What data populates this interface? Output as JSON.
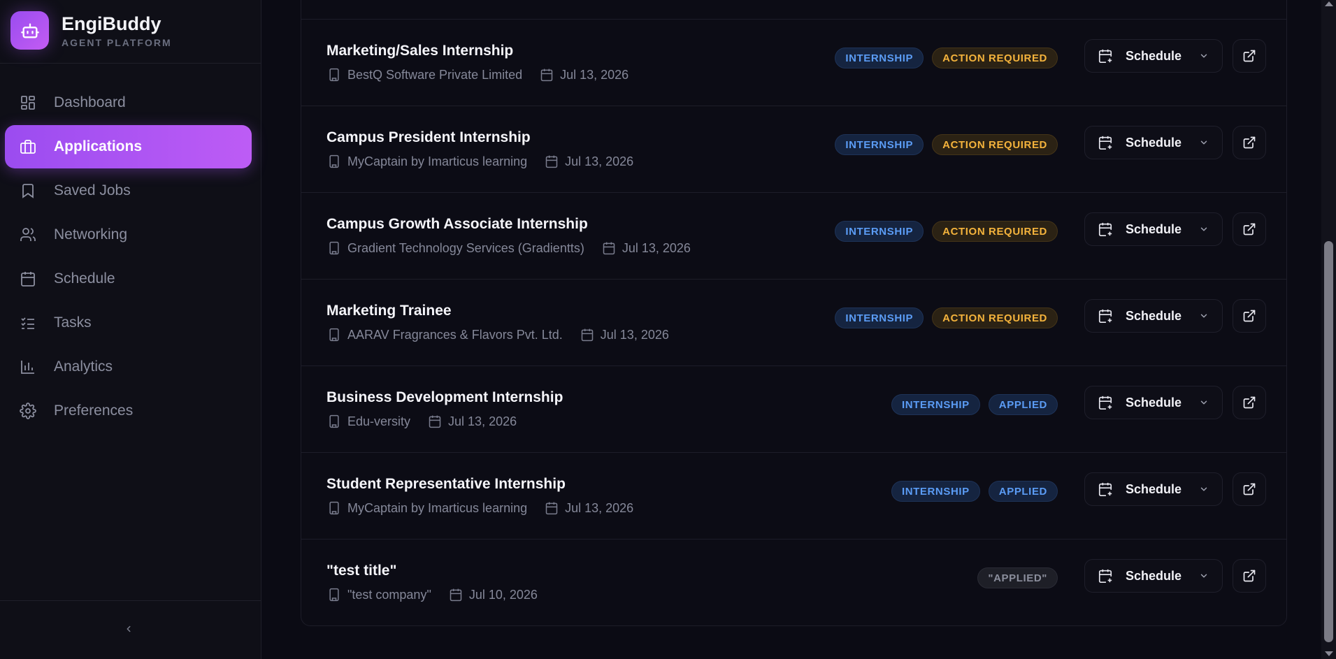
{
  "brand": {
    "name": "EngiBuddy",
    "subtitle": "AGENT PLATFORM",
    "icon": "robot-icon"
  },
  "sidebar": {
    "items": [
      {
        "label": "Dashboard",
        "icon": "dashboard-icon",
        "active": false
      },
      {
        "label": "Applications",
        "icon": "briefcase-icon",
        "active": true
      },
      {
        "label": "Saved Jobs",
        "icon": "bookmark-icon",
        "active": false
      },
      {
        "label": "Networking",
        "icon": "users-icon",
        "active": false
      },
      {
        "label": "Schedule",
        "icon": "calendar-icon",
        "active": false
      },
      {
        "label": "Tasks",
        "icon": "list-checks-icon",
        "active": false
      },
      {
        "label": "Analytics",
        "icon": "bar-chart-icon",
        "active": false
      },
      {
        "label": "Preferences",
        "icon": "gear-icon",
        "active": false
      }
    ],
    "collapse_icon": "chevron-left-icon"
  },
  "applications": [
    {
      "title": "Marketing/Sales Internship",
      "company": "BestQ Software Private Limited",
      "date": "Jul 13, 2026",
      "badges": [
        {
          "text": "INTERNSHIP",
          "tone": "blue"
        },
        {
          "text": "ACTION REQUIRED",
          "tone": "amber"
        }
      ],
      "schedule_label": "Schedule"
    },
    {
      "title": "Campus President Internship",
      "company": "MyCaptain by Imarticus learning",
      "date": "Jul 13, 2026",
      "badges": [
        {
          "text": "INTERNSHIP",
          "tone": "blue"
        },
        {
          "text": "ACTION REQUIRED",
          "tone": "amber"
        }
      ],
      "schedule_label": "Schedule"
    },
    {
      "title": "Campus Growth Associate Internship",
      "company": "Gradient Technology Services (Gradientts)",
      "date": "Jul 13, 2026",
      "badges": [
        {
          "text": "INTERNSHIP",
          "tone": "blue"
        },
        {
          "text": "ACTION REQUIRED",
          "tone": "amber"
        }
      ],
      "schedule_label": "Schedule"
    },
    {
      "title": "Marketing Trainee",
      "company": "AARAV Fragrances & Flavors Pvt. Ltd.",
      "date": "Jul 13, 2026",
      "badges": [
        {
          "text": "INTERNSHIP",
          "tone": "blue"
        },
        {
          "text": "ACTION REQUIRED",
          "tone": "amber"
        }
      ],
      "schedule_label": "Schedule"
    },
    {
      "title": "Business Development Internship",
      "company": "Edu-versity",
      "date": "Jul 13, 2026",
      "badges": [
        {
          "text": "INTERNSHIP",
          "tone": "blue"
        },
        {
          "text": "APPLIED",
          "tone": "blue"
        }
      ],
      "schedule_label": "Schedule"
    },
    {
      "title": "Student Representative Internship",
      "company": "MyCaptain by Imarticus learning",
      "date": "Jul 13, 2026",
      "badges": [
        {
          "text": "INTERNSHIP",
          "tone": "blue"
        },
        {
          "text": "APPLIED",
          "tone": "blue"
        }
      ],
      "schedule_label": "Schedule"
    },
    {
      "title": "\"test title\"",
      "company": "\"test company\"",
      "date": "Jul 10, 2026",
      "badges": [
        {
          "text": "\"APPLIED\"",
          "tone": "gray"
        }
      ],
      "schedule_label": "Schedule"
    }
  ],
  "colors": {
    "accent": "#a855f7",
    "background": "#0b0b14",
    "badge_blue": "#5b9cf5",
    "badge_amber": "#f4b33c"
  }
}
